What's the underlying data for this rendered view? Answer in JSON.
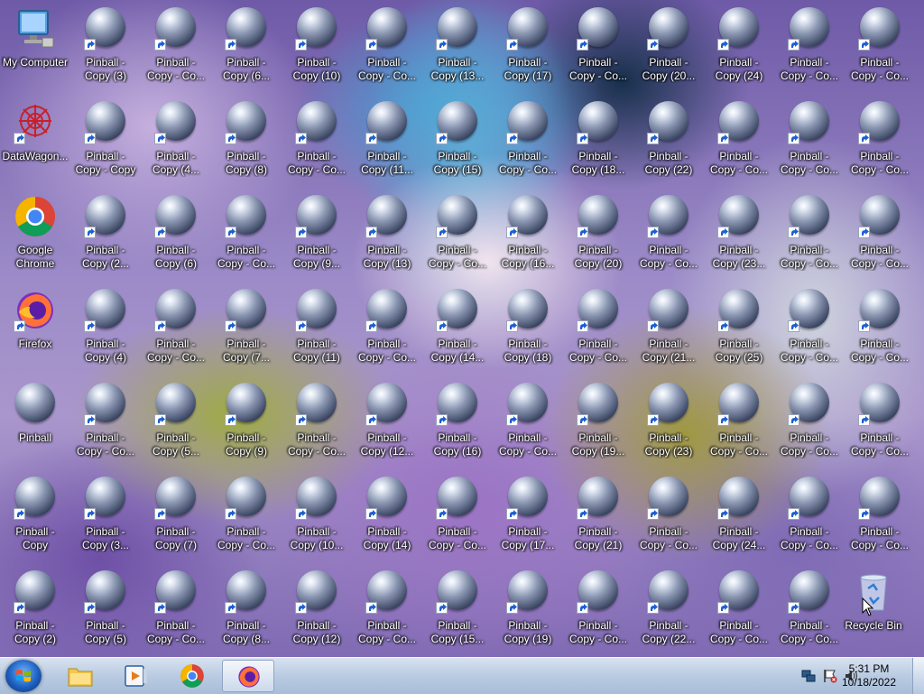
{
  "desktop": {
    "icons": [
      {
        "label": "My Computer",
        "icon": "computer-icon",
        "shortcut": false
      },
      {
        "label": "Pinball -\nCopy (3)",
        "icon": "pinball-icon",
        "shortcut": true
      },
      {
        "label": "Pinball -\nCopy - Co...",
        "icon": "pinball-icon",
        "shortcut": true
      },
      {
        "label": "Pinball -\nCopy (6...",
        "icon": "pinball-icon",
        "shortcut": true
      },
      {
        "label": "Pinball -\nCopy (10)",
        "icon": "pinball-icon",
        "shortcut": true
      },
      {
        "label": "Pinball -\nCopy - Co...",
        "icon": "pinball-icon",
        "shortcut": true
      },
      {
        "label": "Pinball -\nCopy (13...",
        "icon": "pinball-icon",
        "shortcut": true
      },
      {
        "label": "Pinball -\nCopy (17)",
        "icon": "pinball-icon",
        "shortcut": true
      },
      {
        "label": "Pinball -\nCopy - Co...",
        "icon": "pinball-icon",
        "shortcut": true
      },
      {
        "label": "Pinball -\nCopy (20...",
        "icon": "pinball-icon",
        "shortcut": true
      },
      {
        "label": "Pinball -\nCopy (24)",
        "icon": "pinball-icon",
        "shortcut": true
      },
      {
        "label": "Pinball -\nCopy - Co...",
        "icon": "pinball-icon",
        "shortcut": true
      },
      {
        "label": "Pinball -\nCopy - Co...",
        "icon": "pinball-icon",
        "shortcut": true
      },
      {
        "label": "DataWagon...",
        "icon": "datawagon-icon",
        "shortcut": true
      },
      {
        "label": "Pinball -\nCopy - Copy",
        "icon": "pinball-icon",
        "shortcut": true
      },
      {
        "label": "Pinball -\nCopy (4...",
        "icon": "pinball-icon",
        "shortcut": true
      },
      {
        "label": "Pinball -\nCopy (8)",
        "icon": "pinball-icon",
        "shortcut": true
      },
      {
        "label": "Pinball -\nCopy - Co...",
        "icon": "pinball-icon",
        "shortcut": true
      },
      {
        "label": "Pinball -\nCopy (11...",
        "icon": "pinball-icon",
        "shortcut": true
      },
      {
        "label": "Pinball -\nCopy (15)",
        "icon": "pinball-icon",
        "shortcut": true
      },
      {
        "label": "Pinball -\nCopy - Co...",
        "icon": "pinball-icon",
        "shortcut": true
      },
      {
        "label": "Pinball -\nCopy (18...",
        "icon": "pinball-icon",
        "shortcut": true
      },
      {
        "label": "Pinball -\nCopy (22)",
        "icon": "pinball-icon",
        "shortcut": true
      },
      {
        "label": "Pinball -\nCopy - Co...",
        "icon": "pinball-icon",
        "shortcut": true
      },
      {
        "label": "Pinball -\nCopy - Co...",
        "icon": "pinball-icon",
        "shortcut": true
      },
      {
        "label": "Pinball -\nCopy - Co...",
        "icon": "pinball-icon",
        "shortcut": true
      },
      {
        "label": "Google\nChrome",
        "icon": "chrome-icon",
        "shortcut": false
      },
      {
        "label": "Pinball -\nCopy (2...",
        "icon": "pinball-icon",
        "shortcut": true
      },
      {
        "label": "Pinball -\nCopy (6)",
        "icon": "pinball-icon",
        "shortcut": true
      },
      {
        "label": "Pinball -\nCopy - Co...",
        "icon": "pinball-icon",
        "shortcut": true
      },
      {
        "label": "Pinball -\nCopy (9...",
        "icon": "pinball-icon",
        "shortcut": true
      },
      {
        "label": "Pinball -\nCopy (13)",
        "icon": "pinball-icon",
        "shortcut": true
      },
      {
        "label": "Pinball -\nCopy - Co...",
        "icon": "pinball-icon",
        "shortcut": true
      },
      {
        "label": "Pinball -\nCopy (16...",
        "icon": "pinball-icon",
        "shortcut": true
      },
      {
        "label": "Pinball -\nCopy (20)",
        "icon": "pinball-icon",
        "shortcut": true
      },
      {
        "label": "Pinball -\nCopy - Co...",
        "icon": "pinball-icon",
        "shortcut": true
      },
      {
        "label": "Pinball -\nCopy (23...",
        "icon": "pinball-icon",
        "shortcut": true
      },
      {
        "label": "Pinball -\nCopy - Co...",
        "icon": "pinball-icon",
        "shortcut": true
      },
      {
        "label": "Pinball -\nCopy - Co...",
        "icon": "pinball-icon",
        "shortcut": true
      },
      {
        "label": "Firefox",
        "icon": "firefox-icon",
        "shortcut": true
      },
      {
        "label": "Pinball -\nCopy (4)",
        "icon": "pinball-icon",
        "shortcut": true
      },
      {
        "label": "Pinball -\nCopy - Co...",
        "icon": "pinball-icon",
        "shortcut": true
      },
      {
        "label": "Pinball -\nCopy (7...",
        "icon": "pinball-icon",
        "shortcut": true
      },
      {
        "label": "Pinball -\nCopy (11)",
        "icon": "pinball-icon",
        "shortcut": true
      },
      {
        "label": "Pinball -\nCopy - Co...",
        "icon": "pinball-icon",
        "shortcut": true
      },
      {
        "label": "Pinball -\nCopy (14...",
        "icon": "pinball-icon",
        "shortcut": true
      },
      {
        "label": "Pinball -\nCopy (18)",
        "icon": "pinball-icon",
        "shortcut": true
      },
      {
        "label": "Pinball -\nCopy - Co...",
        "icon": "pinball-icon",
        "shortcut": true
      },
      {
        "label": "Pinball -\nCopy (21...",
        "icon": "pinball-icon",
        "shortcut": true
      },
      {
        "label": "Pinball -\nCopy (25)",
        "icon": "pinball-icon",
        "shortcut": true
      },
      {
        "label": "Pinball -\nCopy - Co...",
        "icon": "pinball-icon",
        "shortcut": true
      },
      {
        "label": "Pinball -\nCopy - Co...",
        "icon": "pinball-icon",
        "shortcut": true
      },
      {
        "label": "Pinball",
        "icon": "pinball-icon",
        "shortcut": false
      },
      {
        "label": "Pinball -\nCopy - Co...",
        "icon": "pinball-icon",
        "shortcut": true
      },
      {
        "label": "Pinball -\nCopy (5...",
        "icon": "pinball-icon",
        "shortcut": true
      },
      {
        "label": "Pinball -\nCopy (9)",
        "icon": "pinball-icon",
        "shortcut": true
      },
      {
        "label": "Pinball -\nCopy - Co...",
        "icon": "pinball-icon",
        "shortcut": true
      },
      {
        "label": "Pinball -\nCopy (12...",
        "icon": "pinball-icon",
        "shortcut": true
      },
      {
        "label": "Pinball -\nCopy (16)",
        "icon": "pinball-icon",
        "shortcut": true
      },
      {
        "label": "Pinball -\nCopy - Co...",
        "icon": "pinball-icon",
        "shortcut": true
      },
      {
        "label": "Pinball -\nCopy (19...",
        "icon": "pinball-icon",
        "shortcut": true
      },
      {
        "label": "Pinball -\nCopy (23)",
        "icon": "pinball-icon",
        "shortcut": true
      },
      {
        "label": "Pinball -\nCopy - Co...",
        "icon": "pinball-icon",
        "shortcut": true
      },
      {
        "label": "Pinball -\nCopy - Co...",
        "icon": "pinball-icon",
        "shortcut": true
      },
      {
        "label": "Pinball -\nCopy - Co...",
        "icon": "pinball-icon",
        "shortcut": true
      },
      {
        "label": "Pinball -\nCopy",
        "icon": "pinball-icon",
        "shortcut": true
      },
      {
        "label": "Pinball -\nCopy (3...",
        "icon": "pinball-icon",
        "shortcut": true
      },
      {
        "label": "Pinball -\nCopy (7)",
        "icon": "pinball-icon",
        "shortcut": true
      },
      {
        "label": "Pinball -\nCopy - Co...",
        "icon": "pinball-icon",
        "shortcut": true
      },
      {
        "label": "Pinball -\nCopy (10...",
        "icon": "pinball-icon",
        "shortcut": true
      },
      {
        "label": "Pinball -\nCopy (14)",
        "icon": "pinball-icon",
        "shortcut": true
      },
      {
        "label": "Pinball -\nCopy - Co...",
        "icon": "pinball-icon",
        "shortcut": true
      },
      {
        "label": "Pinball -\nCopy (17...",
        "icon": "pinball-icon",
        "shortcut": true
      },
      {
        "label": "Pinball -\nCopy (21)",
        "icon": "pinball-icon",
        "shortcut": true
      },
      {
        "label": "Pinball -\nCopy - Co...",
        "icon": "pinball-icon",
        "shortcut": true
      },
      {
        "label": "Pinball -\nCopy (24...",
        "icon": "pinball-icon",
        "shortcut": true
      },
      {
        "label": "Pinball -\nCopy - Co...",
        "icon": "pinball-icon",
        "shortcut": true
      },
      {
        "label": "Pinball -\nCopy - Co...",
        "icon": "pinball-icon",
        "shortcut": true
      },
      {
        "label": "Pinball -\nCopy (2)",
        "icon": "pinball-icon",
        "shortcut": true
      },
      {
        "label": "Pinball -\nCopy (5)",
        "icon": "pinball-icon",
        "shortcut": true
      },
      {
        "label": "Pinball -\nCopy - Co...",
        "icon": "pinball-icon",
        "shortcut": true
      },
      {
        "label": "Pinball -\nCopy (8...",
        "icon": "pinball-icon",
        "shortcut": true
      },
      {
        "label": "Pinball -\nCopy (12)",
        "icon": "pinball-icon",
        "shortcut": true
      },
      {
        "label": "Pinball -\nCopy - Co...",
        "icon": "pinball-icon",
        "shortcut": true
      },
      {
        "label": "Pinball -\nCopy (15...",
        "icon": "pinball-icon",
        "shortcut": true
      },
      {
        "label": "Pinball -\nCopy (19)",
        "icon": "pinball-icon",
        "shortcut": true
      },
      {
        "label": "Pinball -\nCopy - Co...",
        "icon": "pinball-icon",
        "shortcut": true
      },
      {
        "label": "Pinball -\nCopy (22...",
        "icon": "pinball-icon",
        "shortcut": true
      },
      {
        "label": "Pinball -\nCopy - Co...",
        "icon": "pinball-icon",
        "shortcut": true
      },
      {
        "label": "Pinball -\nCopy - Co...",
        "icon": "pinball-icon",
        "shortcut": true
      },
      {
        "label": "Recycle Bin",
        "icon": "recycle-bin-icon",
        "shortcut": false
      }
    ]
  },
  "taskbar": {
    "start_button": "start-orb-icon",
    "pinned": [
      {
        "name": "explorer",
        "icon": "folder-icon",
        "active": false
      },
      {
        "name": "media-player",
        "icon": "media-player-icon",
        "active": false
      },
      {
        "name": "chrome",
        "icon": "chrome-icon",
        "active": false
      },
      {
        "name": "firefox",
        "icon": "firefox-icon",
        "active": true
      }
    ],
    "tray": {
      "icons": [
        "network-icon",
        "flag-warning-icon",
        "volume-icon"
      ],
      "time": "5:31 PM",
      "date": "10/18/2022"
    }
  },
  "colors": {
    "taskbar": "#b9cbe2",
    "label_text": "#ffffff"
  }
}
